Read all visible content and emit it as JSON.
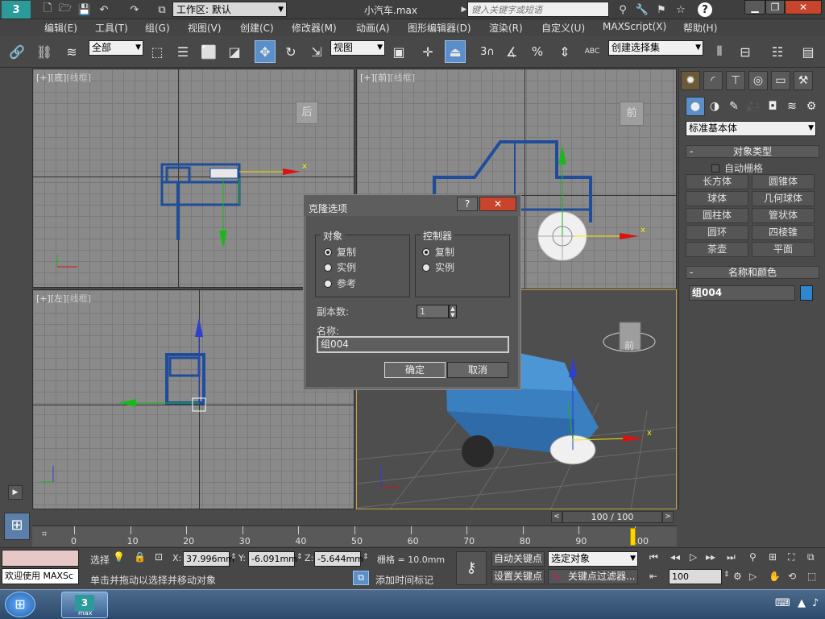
{
  "window": {
    "workspace_label": "工作区: 默认",
    "doc_title": "小汽车.max",
    "search_placeholder": "键入关键字或短语"
  },
  "menu": [
    "编辑(E)",
    "工具(T)",
    "组(G)",
    "视图(V)",
    "创建(C)",
    "修改器(M)",
    "动画(A)",
    "图形编辑器(D)",
    "渲染(R)",
    "自定义(U)",
    "MAXScript(X)",
    "帮助(H)"
  ],
  "toolbar": {
    "filter_select": "全部",
    "ref_coord": "视图",
    "named_selection": "创建选择集",
    "snap_num": "3",
    "angle_label": "%",
    "abc_label": "ABC"
  },
  "viewports": {
    "top": {
      "bracket": "[+]",
      "name": "[底]",
      "mode": "[线框]",
      "cube_label": "后"
    },
    "front": {
      "bracket": "[+]",
      "name": "[前]",
      "mode": "[线框]",
      "cube_label": "前"
    },
    "left": {
      "bracket": "[+]",
      "name": "[左]",
      "mode": "[线框]"
    },
    "persp": {
      "cube_label": "前"
    },
    "axis_x": "x"
  },
  "command_panel": {
    "category": "标准基本体",
    "object_type_title": "对象类型",
    "auto_grid": "自动栅格",
    "buttons": [
      "长方体",
      "圆锥体",
      "球体",
      "几何球体",
      "圆柱体",
      "管状体",
      "圆环",
      "四棱锥",
      "茶壶",
      "平面"
    ],
    "name_color_title": "名称和颜色",
    "object_name": "组004",
    "object_color": "#2f86d0"
  },
  "dialog": {
    "title": "克隆选项",
    "object_group": "对象",
    "object_options": [
      {
        "label": "复制",
        "on": true
      },
      {
        "label": "实例",
        "on": false
      },
      {
        "label": "参考",
        "on": false
      }
    ],
    "controller_group": "控制器",
    "controller_options": [
      {
        "label": "复制",
        "on": true
      },
      {
        "label": "实例",
        "on": false
      }
    ],
    "copies_label": "副本数:",
    "copies_value": "1",
    "name_label": "名称:",
    "name_value": "组004",
    "ok": "确定",
    "cancel": "取消"
  },
  "timeline": {
    "frame_display": "100 / 100",
    "ticks": [
      "0",
      "10",
      "20",
      "30",
      "40",
      "50",
      "60",
      "70",
      "80",
      "90",
      "100"
    ]
  },
  "status": {
    "welcome": "欢迎使用 MAXSc",
    "select_label": "选择",
    "x_label": "X:",
    "x_value": "37.996mm",
    "y_label": "Y:",
    "y_value": "-6.091mm",
    "z_label": "Z:",
    "z_value": "-5.644mm",
    "grid": "栅格 = 10.0mm",
    "auto_key": "自动关键点",
    "set_key": "设置关键点",
    "key_mode": "选定对象",
    "key_filter": "关键点过滤器...",
    "frame_field": "100",
    "prompt": "单击并拖动以选择并移动对象",
    "add_time_tag": "添加时间标记"
  },
  "taskbar": {
    "app_label": "max"
  }
}
